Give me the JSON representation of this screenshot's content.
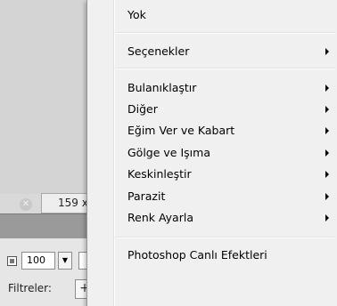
{
  "background": {
    "size_tab_label": "159 x",
    "zoom_value": "100",
    "filters_label": "Filtreler:"
  },
  "menu": {
    "items": [
      {
        "label": "Yok",
        "submenu": false
      },
      {
        "label": "Seçenekler",
        "submenu": true
      },
      {
        "label": "Bulanıklaştır",
        "submenu": true
      },
      {
        "label": "Diğer",
        "submenu": true
      },
      {
        "label": "Eğim Ver ve Kabart",
        "submenu": true
      },
      {
        "label": "Gölge ve Işıma",
        "submenu": true
      },
      {
        "label": "Keskinleştir",
        "submenu": true
      },
      {
        "label": "Parazit",
        "submenu": true
      },
      {
        "label": "Renk Ayarla",
        "submenu": true
      },
      {
        "label": "Photoshop Canlı Efektleri",
        "submenu": false
      }
    ]
  }
}
